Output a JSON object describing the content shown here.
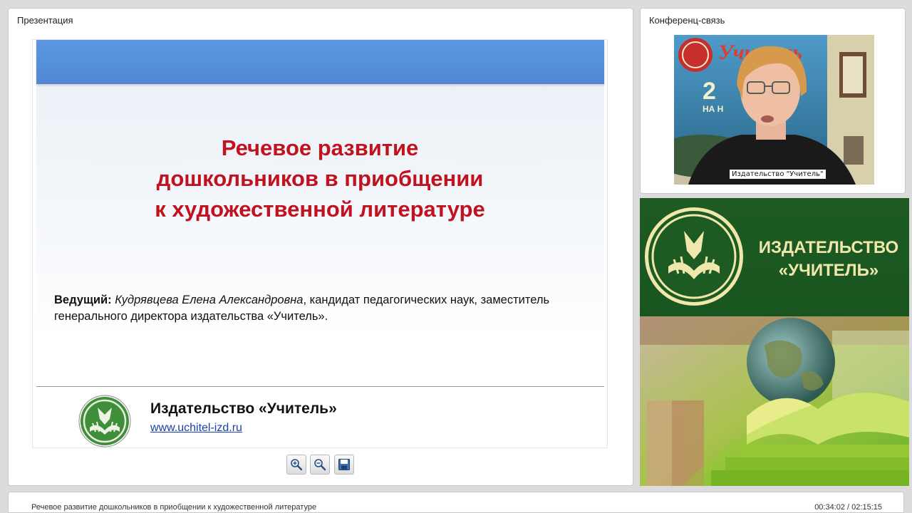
{
  "presentation": {
    "panel_title": "Презентация",
    "slide": {
      "title_lines": [
        "Речевое развитие",
        "дошкольников в приобщении",
        "к художественной литературе"
      ],
      "host_label": "Ведущий:",
      "host_name": "Кудрявцева Елена Александровна",
      "host_desc_line1": ", кандидат педагогических наук, заместитель",
      "host_desc_line2": "генерального директора издательства «Учитель».",
      "publisher_name": "Издательство «Учитель»",
      "publisher_url": "www.uchitel-izd.ru"
    },
    "toolbar": [
      {
        "name": "zoom-in",
        "icon": "zoom-in-icon"
      },
      {
        "name": "zoom-out",
        "icon": "zoom-out-icon"
      },
      {
        "name": "save",
        "icon": "save-icon"
      }
    ]
  },
  "conference": {
    "panel_title": "Конференц-связь",
    "video_caption": "Издательство \"Учитель\"",
    "backdrop_text": "Учитель"
  },
  "banner": {
    "line1": "ИЗДАТЕЛЬСТВО",
    "line2": "«УЧИТЕЛЬ»"
  },
  "footer": {
    "title": "Речевое развитие дошкольников в приобщении к художественной литературе",
    "time": "00:34:02 / 02:15:15"
  },
  "colors": {
    "slide_title": "#c1121f",
    "banner_green": "#1e5b22",
    "banner_text": "#efe7ab"
  }
}
